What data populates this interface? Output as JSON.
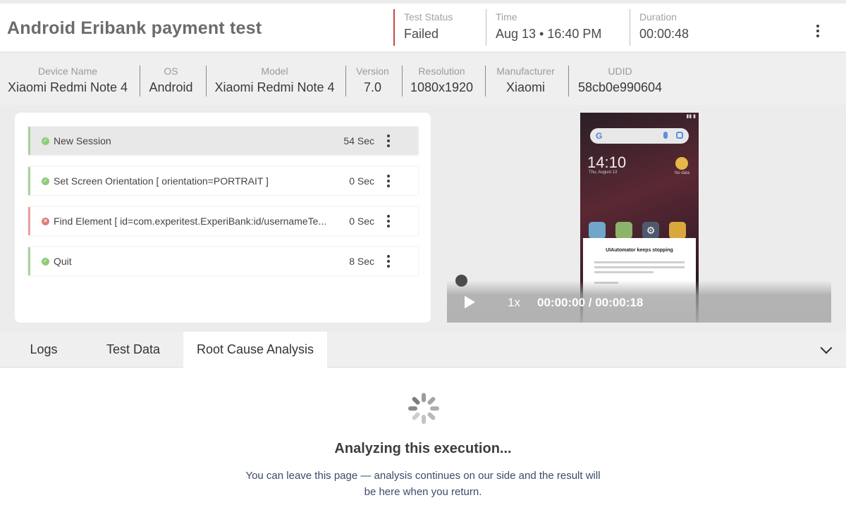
{
  "header": {
    "title": "Android Eribank payment test",
    "status_label": "Test Status",
    "status_value": "Failed",
    "time_label": "Time",
    "time_value": "Aug 13 • 16:40 PM",
    "duration_label": "Duration",
    "duration_value": "00:00:48"
  },
  "device": [
    {
      "label": "Device Name",
      "value": "Xiaomi Redmi Note 4"
    },
    {
      "label": "OS",
      "value": "Android"
    },
    {
      "label": "Model",
      "value": "Xiaomi Redmi Note 4"
    },
    {
      "label": "Version",
      "value": "7.0"
    },
    {
      "label": "Resolution",
      "value": "1080x1920"
    },
    {
      "label": "Manufacturer",
      "value": "Xiaomi"
    },
    {
      "label": "UDID",
      "value": "58cb0e990604"
    }
  ],
  "steps": [
    {
      "name": "New Session",
      "duration": "54 Sec",
      "status": "passed"
    },
    {
      "name": "Set Screen Orientation [ orientation=PORTRAIT ]",
      "duration": "0 Sec",
      "status": "passed"
    },
    {
      "name": "Find Element [ id=com.experitest.ExperiBank:id/usernameTe...",
      "duration": "0 Sec",
      "status": "failed"
    },
    {
      "name": "Quit",
      "duration": "8 Sec",
      "status": "passed"
    }
  ],
  "video": {
    "speed": "1x",
    "time": "00:00:00 / 00:00:18",
    "phone_clock": "14:10",
    "phone_date": "Thu, August 13",
    "phone_weather": "No data",
    "phone_dialog_title": "UIAutomator keeps stopping"
  },
  "tabs": [
    {
      "label": "Logs",
      "active": false
    },
    {
      "label": "Test Data",
      "active": false
    },
    {
      "label": "Root Cause Analysis",
      "active": true
    }
  ],
  "analysis": {
    "title": "Analyzing this execution...",
    "message": "You can leave this page — analysis continues on our side and the result will be here when you return."
  },
  "colors": {
    "failed": "#c9464c",
    "passed": "#8fcb7d",
    "message_text": "#3c4a6a"
  }
}
